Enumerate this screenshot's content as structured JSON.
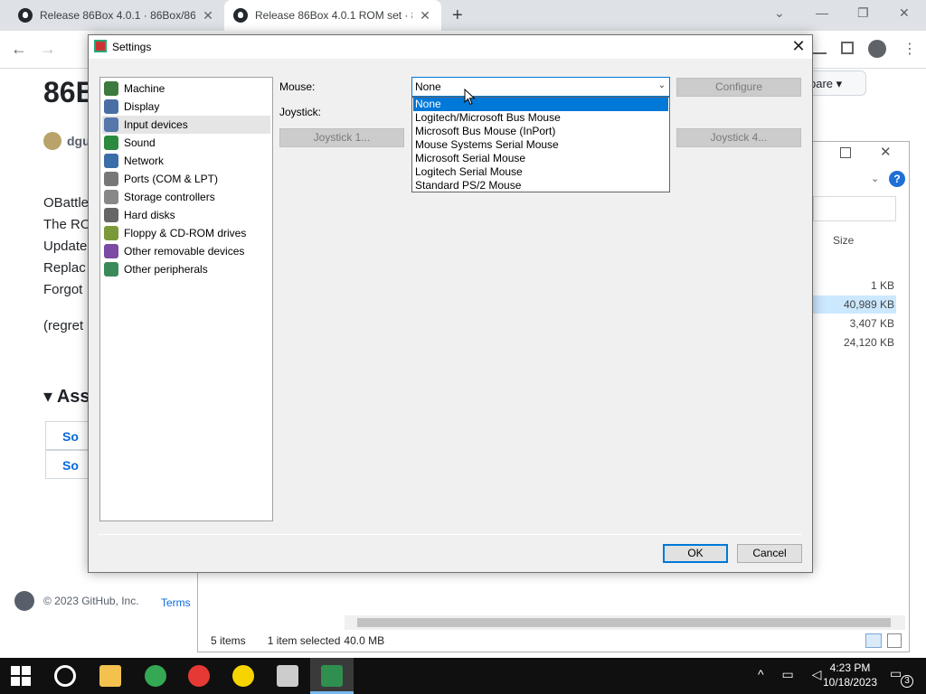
{
  "browser": {
    "tabs": [
      {
        "title": "Release 86Box 4.0.1 · 86Box/86B",
        "active": false,
        "close": "✕"
      },
      {
        "title": "Release 86Box 4.0.1 ROM set · 86",
        "active": true,
        "close": "✕"
      }
    ],
    "new_tab": "+",
    "window_controls": {
      "chevron": "⌄",
      "minimize": "—",
      "restore": "❐",
      "close": "✕"
    },
    "nav": {
      "back": "←",
      "forward": "→"
    }
  },
  "github_page": {
    "title": "86B",
    "username": "dgu",
    "lines": [
      "OBattle",
      "The RO",
      "Update",
      "Replac",
      "Forgot",
      "(regret"
    ],
    "assets_heading": "▾ Ass",
    "assets": [
      "So",
      "So"
    ],
    "compare_btn": "pare ▾",
    "footer": "© 2023 GitHub, Inc.",
    "terms": "Terms"
  },
  "explorer": {
    "size_header": "Size",
    "sizes": [
      "1 KB",
      "40,989 KB",
      "3,407 KB",
      "24,120 KB"
    ],
    "status": {
      "items": "5 items",
      "selected": "1 item selected",
      "size": "40.0 MB"
    },
    "help": "?"
  },
  "settings": {
    "title": "Settings",
    "close": "✕",
    "categories": [
      {
        "label": "Machine",
        "color": "#3d7a3d"
      },
      {
        "label": "Display",
        "color": "#4a6fa5"
      },
      {
        "label": "Input devices",
        "color": "#5577aa",
        "selected": true
      },
      {
        "label": "Sound",
        "color": "#2b8a3e"
      },
      {
        "label": "Network",
        "color": "#3b6ea8"
      },
      {
        "label": "Ports (COM & LPT)",
        "color": "#777777"
      },
      {
        "label": "Storage controllers",
        "color": "#888888"
      },
      {
        "label": "Hard disks",
        "color": "#666666"
      },
      {
        "label": "Floppy & CD-ROM drives",
        "color": "#7a9a3a"
      },
      {
        "label": "Other removable devices",
        "color": "#7a4aa5"
      },
      {
        "label": "Other peripherals",
        "color": "#3a8a5a"
      }
    ],
    "mouse_label": "Mouse:",
    "joystick_label": "Joystick:",
    "mouse_value": "None",
    "mouse_options": [
      "None",
      "Logitech/Microsoft Bus Mouse",
      "Microsoft Bus Mouse (InPort)",
      "Mouse Systems Serial Mouse",
      "Microsoft Serial Mouse",
      "Logitech Serial Mouse",
      "Standard PS/2 Mouse"
    ],
    "highlighted_option": "None",
    "configure_btn": "Configure",
    "joystick1_btn": "Joystick 1...",
    "joystick4_btn": "Joystick 4...",
    "ok_btn": "OK",
    "cancel_btn": "Cancel"
  },
  "taskbar": {
    "time": "4:23 PM",
    "date": "10/18/2023",
    "notifications": "3",
    "apps": [
      {
        "name": "file-explorer",
        "color": "#f2c14e"
      },
      {
        "name": "chrome",
        "color": "#34a853"
      },
      {
        "name": "yandex-browser",
        "color": "#e53935"
      },
      {
        "name": "yandex-market",
        "color": "#f7d400"
      },
      {
        "name": "7zip",
        "color": "#cccccc"
      },
      {
        "name": "86box",
        "color": "#2f8f4f"
      }
    ]
  }
}
